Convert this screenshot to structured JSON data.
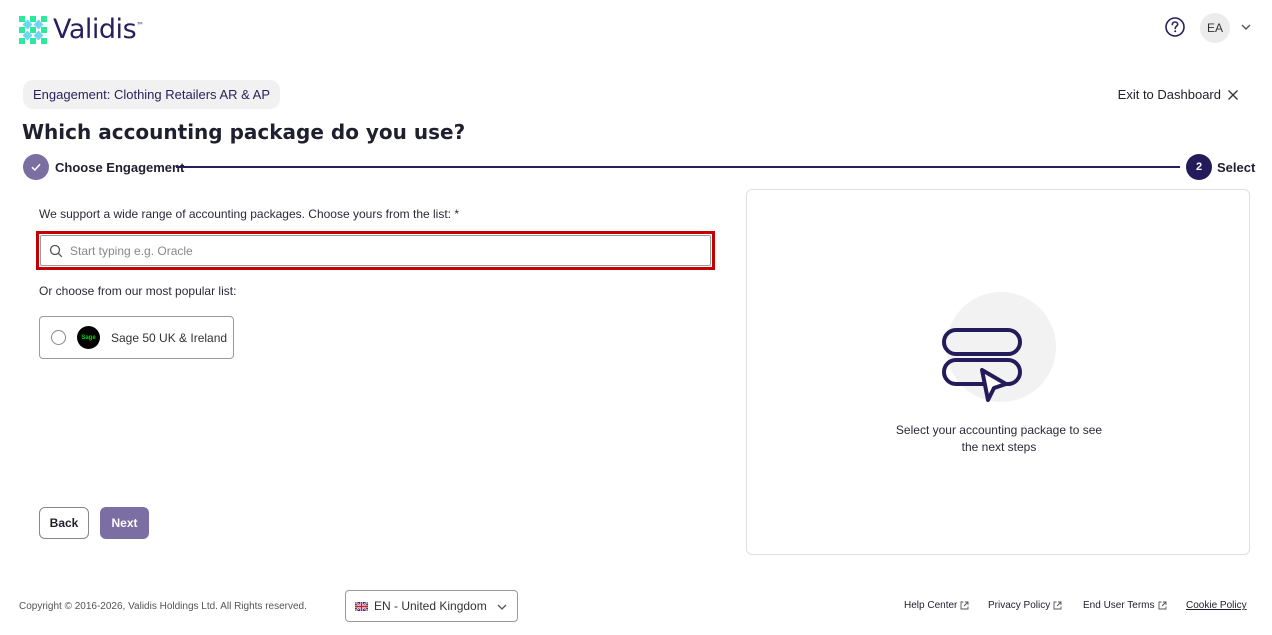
{
  "header": {
    "logo_text": "Validis",
    "trademark": "™",
    "avatar_initials": "EA",
    "icons": {
      "help": "help-circle-icon",
      "avatar_menu": "chevron-down-icon"
    }
  },
  "engagement": {
    "pill_label": "Engagement: Clothing Retailers AR & AP",
    "exit_label": "Exit to Dashboard"
  },
  "page": {
    "title": "Which accounting package do you use?"
  },
  "stepper": {
    "steps": [
      {
        "label": "Choose Engagement",
        "state": "completed"
      },
      {
        "number": "2",
        "label": "Select",
        "state": "active"
      }
    ]
  },
  "form": {
    "support_text": "We support a wide range of accounting packages. Choose yours from the list: *",
    "search_placeholder": "Start typing e.g. Oracle",
    "search_value": "",
    "popular_text": "Or choose from our most popular list:",
    "options": [
      {
        "label": "Sage 50 UK & Ireland",
        "logo_text": "Sage",
        "selected": false
      }
    ],
    "back_label": "Back",
    "next_label": "Next"
  },
  "panel": {
    "line1": "Select your accounting package to see",
    "line2": "the next steps"
  },
  "footer": {
    "copyright": "Copyright © 2016-2026, Validis Holdings Ltd. All Rights reserved.",
    "language": "EN - United Kingdom",
    "links": {
      "help": "Help Center",
      "privacy": "Privacy Policy",
      "terms": "End User Terms",
      "cookie": "Cookie Policy"
    }
  },
  "colors": {
    "brand_dark": "#241b5a",
    "brand_muted": "#7a6ea3",
    "logo_green": "#2ee89c",
    "highlight_outline": "#c40000",
    "sage_green": "#00dc00"
  }
}
